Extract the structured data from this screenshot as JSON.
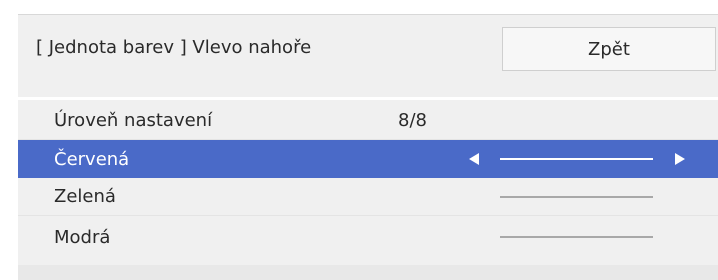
{
  "header": {
    "title": "[ Jednota barev ] Vlevo nahoře",
    "back_label": "Zpět"
  },
  "rows": [
    {
      "label": "Úroveň nastavení",
      "value": "8/8"
    },
    {
      "label": "Červená",
      "selected": true
    },
    {
      "label": "Zelená"
    },
    {
      "label": "Modrá"
    }
  ],
  "colors": {
    "selected_bg": "#4a6ac8",
    "panel_bg": "#f0f0f0"
  },
  "icons": {
    "left": "triangle-left-icon",
    "right": "triangle-right-icon"
  }
}
